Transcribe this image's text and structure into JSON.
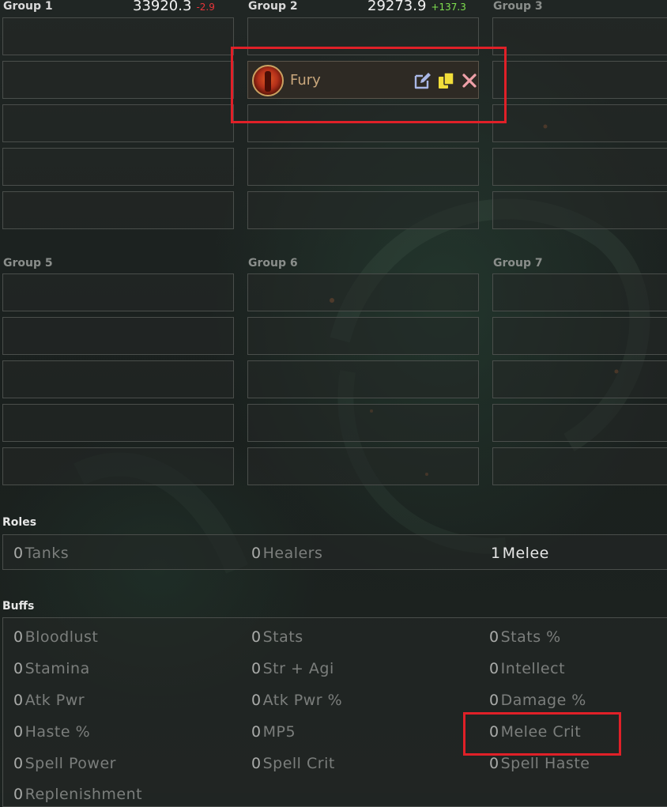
{
  "groups": [
    {
      "title": "Group 1",
      "score": "33920.3",
      "delta": "-2.9",
      "delta_sign": "neg",
      "slots": [
        "",
        "",
        "",
        "",
        ""
      ]
    },
    {
      "title": "Group 2",
      "score": "29273.9",
      "delta": "+137.3",
      "delta_sign": "pos",
      "slots": [
        "",
        "Fury",
        "",
        "",
        ""
      ]
    },
    {
      "title": "Group 3",
      "slots": [
        "",
        "",
        "",
        "",
        ""
      ]
    },
    {
      "title": "Group 5",
      "slots": [
        "",
        "",
        "",
        "",
        ""
      ]
    },
    {
      "title": "Group 6",
      "slots": [
        "",
        "",
        "",
        "",
        ""
      ]
    },
    {
      "title": "Group 7",
      "slots": [
        "",
        "",
        "",
        "",
        ""
      ]
    }
  ],
  "player": {
    "name": "Fury",
    "icon": "fury-warrior-icon"
  },
  "slot_actions": {
    "edit_icon": "edit-icon",
    "copy_icon": "copy-icon",
    "remove_icon": "close-icon"
  },
  "roles": {
    "title": "Roles",
    "items": [
      {
        "count": "0",
        "label": "Tanks",
        "active": false
      },
      {
        "count": "0",
        "label": "Healers",
        "active": false
      },
      {
        "count": "1",
        "label": "Melee",
        "active": true
      }
    ]
  },
  "buffs": {
    "title": "Buffs",
    "rows": [
      [
        {
          "count": "0",
          "label": "Bloodlust"
        },
        {
          "count": "0",
          "label": "Stats"
        },
        {
          "count": "0",
          "label": "Stats %"
        }
      ],
      [
        {
          "count": "0",
          "label": "Stamina"
        },
        {
          "count": "0",
          "label": "Str + Agi"
        },
        {
          "count": "0",
          "label": "Intellect"
        }
      ],
      [
        {
          "count": "0",
          "label": "Atk Pwr"
        },
        {
          "count": "0",
          "label": "Atk Pwr %"
        },
        {
          "count": "0",
          "label": "Damage %"
        }
      ],
      [
        {
          "count": "0",
          "label": "Haste %"
        },
        {
          "count": "0",
          "label": "MP5"
        },
        {
          "count": "0",
          "label": "Melee Crit"
        }
      ],
      [
        {
          "count": "0",
          "label": "Spell Power"
        },
        {
          "count": "0",
          "label": "Spell Crit"
        },
        {
          "count": "0",
          "label": "Spell Haste"
        }
      ],
      [
        {
          "count": "0",
          "label": "Replenishment"
        }
      ]
    ]
  },
  "colors": {
    "highlight": "#e02028",
    "delta_negative": "#e8353a",
    "delta_positive": "#7fe04f",
    "player_name": "#c9a77c"
  }
}
